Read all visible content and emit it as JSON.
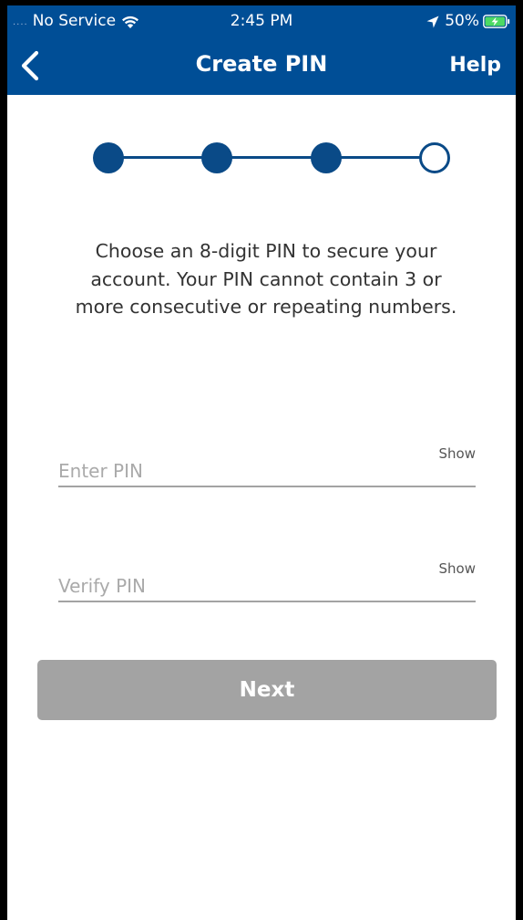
{
  "status_bar": {
    "signal": "....",
    "carrier": "No Service",
    "time": "2:45 PM",
    "battery": "50%",
    "icons": [
      "wifi-icon",
      "location-arrow-icon",
      "battery-charging-icon"
    ]
  },
  "nav": {
    "title": "Create PIN",
    "help_label": "Help",
    "back_icon": "chevron-left-icon"
  },
  "stepper": {
    "total_steps": 4,
    "completed_steps": 3
  },
  "instructions": "Choose an 8-digit PIN to secure your account. Your PIN cannot contain 3 or more consecutive or repeating numbers.",
  "form": {
    "enter_pin": {
      "placeholder": "Enter PIN",
      "value": "",
      "show_label": "Show"
    },
    "verify_pin": {
      "placeholder": "Verify PIN",
      "value": "",
      "show_label": "Show"
    }
  },
  "next_button": {
    "label": "Next",
    "enabled": false
  },
  "colors": {
    "header_bg": "#004e96",
    "stepper": "#0a4a87",
    "button_disabled": "#a3a3a3",
    "field_underline": "#a3a3a3"
  }
}
